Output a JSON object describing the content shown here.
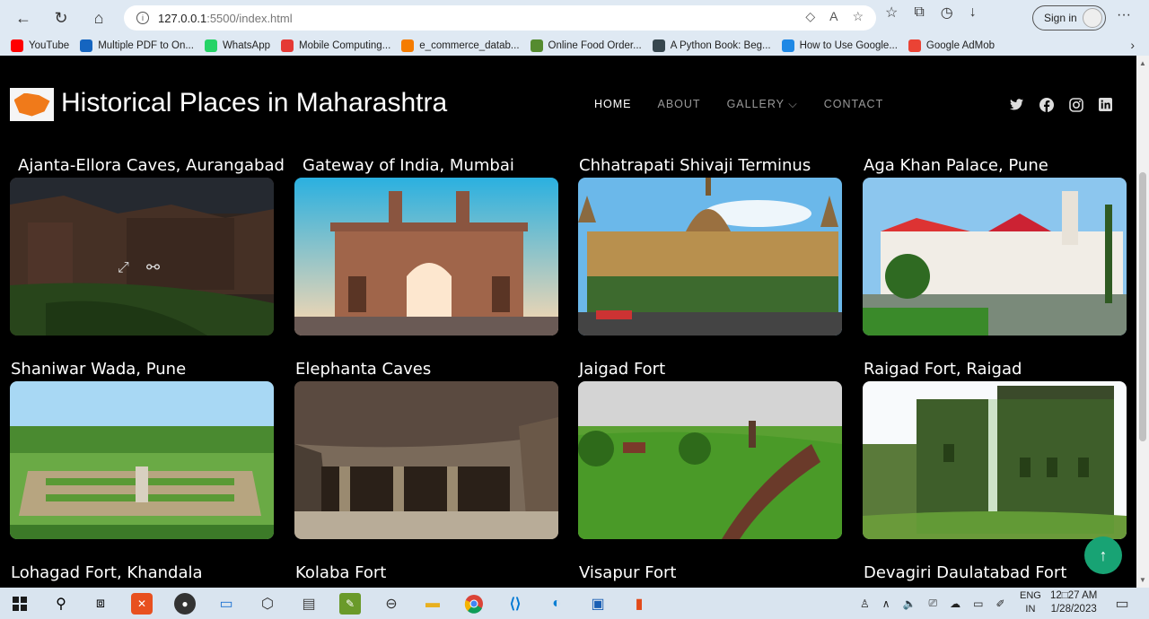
{
  "browser": {
    "url_host": "127.0.0.1",
    "url_rest": ":5500/index.html",
    "signin_label": "Sign in",
    "bookmarks": [
      {
        "label": "YouTube",
        "color": "#ff0000"
      },
      {
        "label": "Multiple PDF to On...",
        "color": "#1565c0"
      },
      {
        "label": "WhatsApp",
        "color": "#25d366"
      },
      {
        "label": "Mobile Computing...",
        "color": "#e53935"
      },
      {
        "label": "e_commerce_datab...",
        "color": "#f57c00"
      },
      {
        "label": "Online Food Order...",
        "color": "#558b2f"
      },
      {
        "label": "A Python Book: Beg...",
        "color": "#37474f"
      },
      {
        "label": "How to Use Google...",
        "color": "#1e88e5"
      },
      {
        "label": "Google AdMob",
        "color": "#ea4335"
      }
    ]
  },
  "site": {
    "title": "Historical Places in Maharashtra",
    "nav": [
      {
        "label": "HOME",
        "active": true
      },
      {
        "label": "ABOUT",
        "active": false
      },
      {
        "label": "GALLERY ⌵",
        "active": false
      },
      {
        "label": "CONTACT",
        "active": false
      }
    ],
    "social": [
      "twitter-icon",
      "facebook-icon",
      "instagram-icon",
      "linkedin-icon"
    ],
    "places": [
      {
        "name": "Ajanta-Ellora Caves, Aurangabad"
      },
      {
        "name": "Gateway of India, Mumbai"
      },
      {
        "name": "Chhatrapati Shivaji Terminus"
      },
      {
        "name": "Aga Khan Palace, Pune"
      },
      {
        "name": "Shaniwar Wada, Pune"
      },
      {
        "name": "Elephanta Caves"
      },
      {
        "name": "Jaigad Fort"
      },
      {
        "name": "Raigad Fort, Raigad"
      },
      {
        "name": "Lohagad Fort, Khandala"
      },
      {
        "name": "Kolaba Fort"
      },
      {
        "name": "Visapur Fort"
      },
      {
        "name": "Devagiri Daulatabad Fort"
      }
    ]
  },
  "taskbar": {
    "lang_top": "ENG",
    "lang_bottom": "IN",
    "time": "12□27 AM",
    "date": "1/28/2023"
  }
}
